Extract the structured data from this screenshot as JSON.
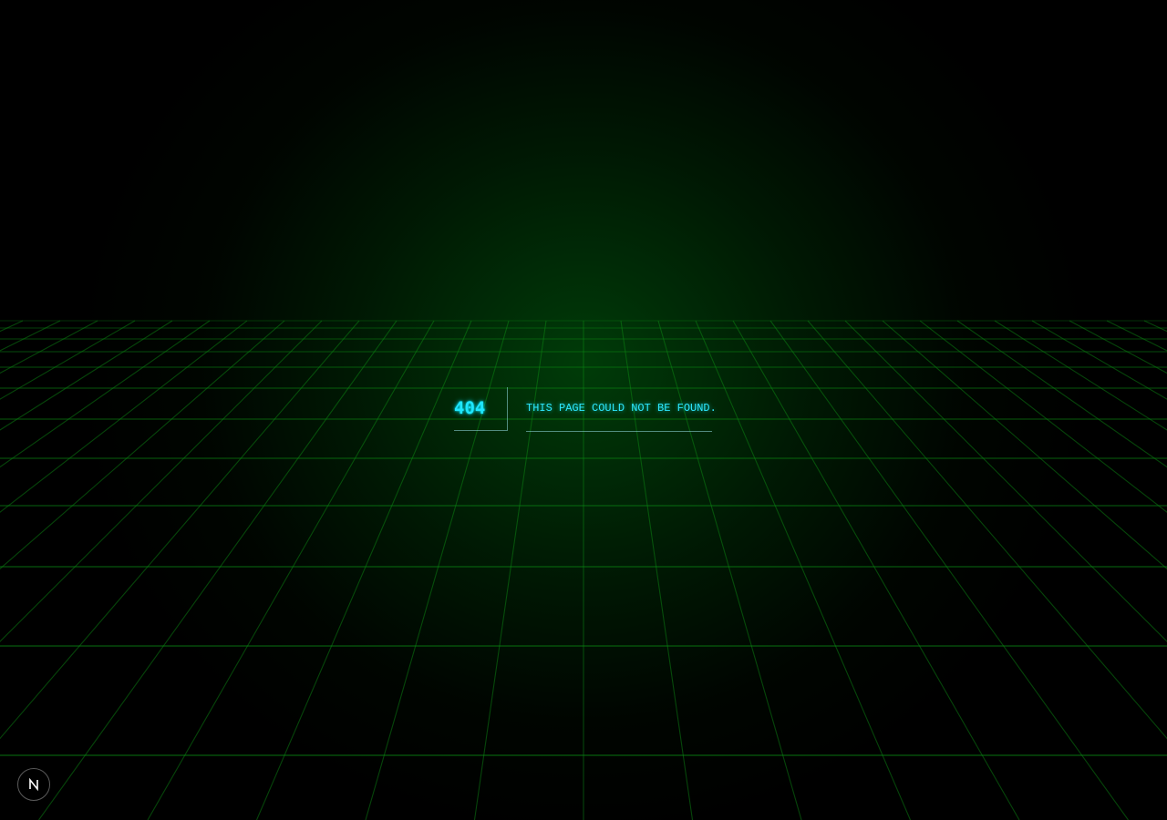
{
  "error": {
    "code": "404",
    "message": "This page could not be found."
  },
  "dev_indicator": {
    "icon": "nextjs-logo-icon",
    "letter": "N"
  },
  "colors": {
    "background": "#000000",
    "grid": "#0b8a14",
    "accent": "#1fe6ff"
  }
}
